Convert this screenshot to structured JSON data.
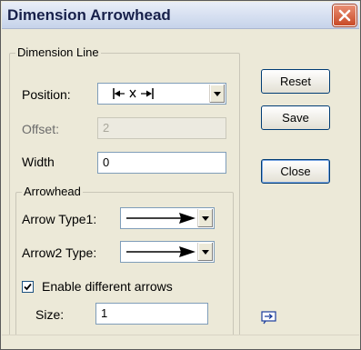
{
  "window": {
    "title": "Dimension Arrowhead",
    "close_glyph": "close-icon"
  },
  "dimension_line": {
    "legend": "Dimension Line",
    "position_label": "Position:",
    "position_value_icon": "arrows-outside-x-icon",
    "offset_label": "Offset:",
    "offset_value": "2",
    "width_label": "Width",
    "width_value": "0"
  },
  "arrowhead": {
    "legend": "Arrowhead",
    "type1_label": "Arrow Type1:",
    "type2_label": "Arrow2 Type:",
    "type1_icon": "filled-arrow-icon",
    "type2_icon": "filled-arrow-icon",
    "enable_label": "Enable different arrows",
    "enable_checked": true,
    "size_label": "Size:",
    "size_value": "1"
  },
  "buttons": {
    "reset": "Reset",
    "save": "Save",
    "close": "Close"
  },
  "colors": {
    "title_text": "#17204a",
    "close_button": "#c94a26",
    "dialog_bg": "#ece9d8"
  }
}
